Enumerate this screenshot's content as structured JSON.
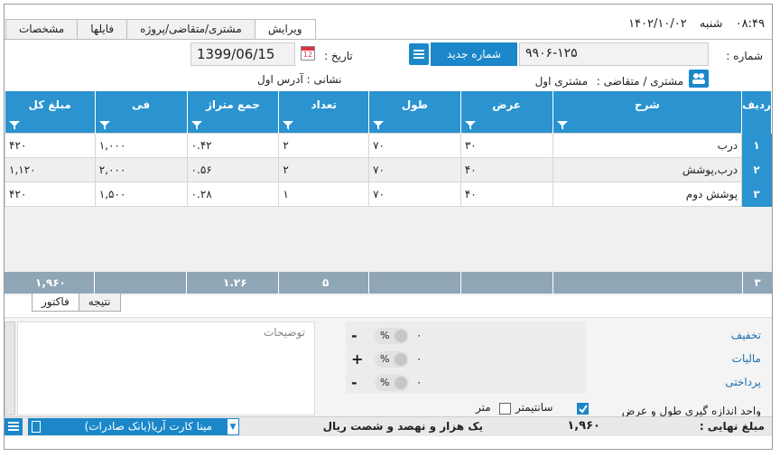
{
  "topbar": {
    "time": "۰۸:۴۹",
    "weekday": "شنبه",
    "date": "۱۴۰۲/۱۰/۰۲",
    "tabs": [
      "ویرایش",
      "مشتری/متقاضی/پروژه",
      "فایلها",
      "مشخصات"
    ]
  },
  "header": {
    "number_label": "شماره :",
    "number_value": "۹۹۰۶-۱۲۵",
    "new_number_button": "شماره جدید",
    "date_label": "تاریخ :",
    "date_value": "1399/06/15",
    "customer_label": "مشتری / متقاضی :",
    "customer_value": "مشتری اول",
    "address_label": "نشانی :",
    "address_value": "آدرس اول"
  },
  "grid": {
    "columns": [
      "ردیف",
      "شرح",
      "عرض",
      "طول",
      "تعداد",
      "جمع متراژ",
      "فی",
      "مبلغ کل"
    ],
    "rows": [
      {
        "idx": "۱",
        "desc": "درب",
        "width": "۳۰",
        "length": "۷۰",
        "count": "۲",
        "area": "۰.۴۲",
        "unit": "۱,۰۰۰",
        "total": "۴۲۰"
      },
      {
        "idx": "۲",
        "desc": "درب,پوشش",
        "width": "۴۰",
        "length": "۷۰",
        "count": "۲",
        "area": "۰.۵۶",
        "unit": "۲,۰۰۰",
        "total": "۱,۱۲۰"
      },
      {
        "idx": "۳",
        "desc": "پوشش دوم",
        "width": "۴۰",
        "length": "۷۰",
        "count": "۱",
        "area": "۰.۲۸",
        "unit": "۱,۵۰۰",
        "total": "۴۲۰"
      }
    ],
    "footer": {
      "idx": "۳",
      "count": "۵",
      "area": "۱.۲۶",
      "total": "۱,۹۶۰"
    }
  },
  "subtabs": [
    "نتیجه",
    "فاکتور"
  ],
  "lower": {
    "notes_placeholder": "توضیحات",
    "discount_label": "تخفیف",
    "tax_label": "مالیات",
    "payment_label": "پرداختی",
    "pct_symbol": "%",
    "discount_value": "۰",
    "tax_value": "۰",
    "payment_value": "۰",
    "discount_sign": "-",
    "tax_sign": "+",
    "payment_sign": "-",
    "unit_label": "واحد اندازه گیری طول و عرض",
    "unit_cm": "سانتیمتر",
    "unit_m": "متر",
    "unit_cm_checked": true,
    "unit_m_checked": false
  },
  "status": {
    "bank": "مینا کارت آریا(بانک صادرات)",
    "amount_words": "یک هزار و نهصد و شصت ریال",
    "final_amount": "۱,۹۶۰",
    "final_label": "مبلغ نهایی :"
  },
  "colors": {
    "accent": "#1b87c9",
    "header": "#2a93d0",
    "footer": "#8fa6b7"
  }
}
